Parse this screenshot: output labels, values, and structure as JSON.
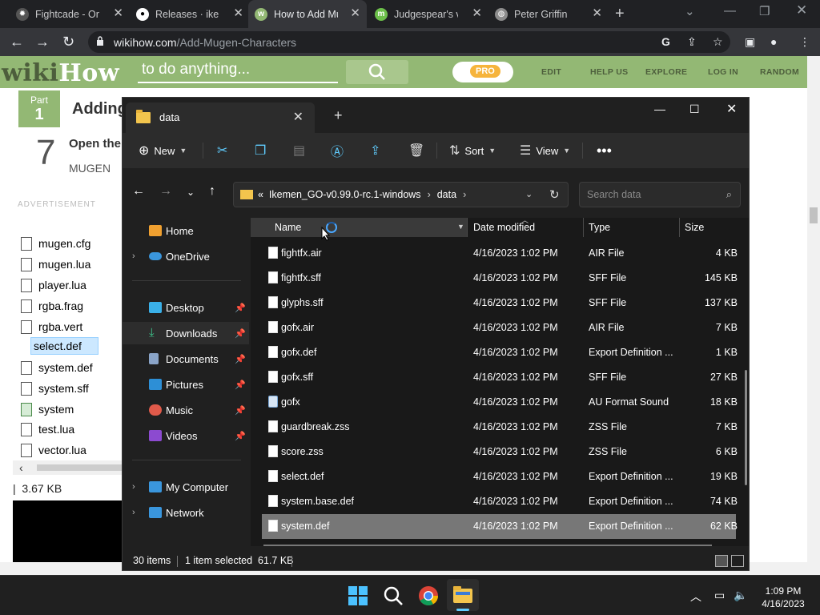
{
  "browser": {
    "tabs": [
      {
        "title": "Fightcade - Onl",
        "icon": "fightcade-icon",
        "color": "#6b6b6b"
      },
      {
        "title": "Releases · ikem",
        "icon": "github-icon",
        "color": "#ffffff"
      },
      {
        "title": "How to Add Mu",
        "icon": "wikihow-icon",
        "color": "#93b874"
      },
      {
        "title": "Judgespear's ve",
        "icon": "judgespear-icon",
        "color": "#6cc04a"
      },
      {
        "title": "Peter Griffin",
        "icon": "globe-icon",
        "color": "#8c8c8c"
      }
    ],
    "url_domain": "wikihow.com",
    "url_path": "/Add-Mugen-Characters"
  },
  "wikihow": {
    "logo_wiki": "wiki",
    "logo_how": "How",
    "search_placeholder": "to do anything...",
    "pro_label": "PRO",
    "nav": [
      "EDIT",
      "HELP US",
      "EXPLORE",
      "LOG IN",
      "RANDOM"
    ],
    "part_label": "Part",
    "part_number": "1",
    "heading": "Adding",
    "step_number": "7",
    "step_title": "Open the",
    "step_text": "MUGEN",
    "ad_label": "ADVERTISEMENT",
    "bg_files": [
      "mugen.cfg",
      "mugen.lua",
      "player.lua",
      "rgba.frag",
      "rgba.vert",
      "select.def",
      "system.def",
      "system.sff",
      "system",
      "test.lua",
      "vector.lua"
    ],
    "bg_status": "3.67 KB"
  },
  "explorer": {
    "tab_title": "data",
    "commands": {
      "new": "New",
      "sort": "Sort",
      "view": "View"
    },
    "breadcrumb": [
      "Ikemen_GO-v0.99.0-rc.1-windows",
      "data"
    ],
    "search_placeholder": "Search data",
    "nav_pane": [
      {
        "label": "Home",
        "icon": "home-icon",
        "color": "#f0a030",
        "arrow": "",
        "pin": false
      },
      {
        "label": "OneDrive",
        "icon": "onedrive-icon",
        "color": "#3a96dd",
        "arrow": "›",
        "pin": false
      },
      {
        "label": "Desktop",
        "icon": "desktop-icon",
        "color": "#3ab0e8",
        "arrow": "",
        "pin": true
      },
      {
        "label": "Downloads",
        "icon": "downloads-icon",
        "color": "#3ec58c",
        "arrow": "",
        "pin": true
      },
      {
        "label": "Documents",
        "icon": "documents-icon",
        "color": "#8aa4c8",
        "arrow": "",
        "pin": true
      },
      {
        "label": "Pictures",
        "icon": "pictures-icon",
        "color": "#2d8fd6",
        "arrow": "",
        "pin": true
      },
      {
        "label": "Music",
        "icon": "music-icon",
        "color": "#e05a4a",
        "arrow": "",
        "pin": true
      },
      {
        "label": "Videos",
        "icon": "videos-icon",
        "color": "#8c4ad0",
        "arrow": "",
        "pin": true
      },
      {
        "label": "My Computer",
        "icon": "computer-icon",
        "color": "#3a96dd",
        "arrow": "›",
        "pin": false
      },
      {
        "label": "Network",
        "icon": "network-icon",
        "color": "#3a96dd",
        "arrow": "›",
        "pin": false
      }
    ],
    "columns": [
      "Name",
      "Date modified",
      "Type",
      "Size"
    ],
    "files": [
      {
        "name": "fightfx.air",
        "date": "4/16/2023 1:02 PM",
        "type": "AIR File",
        "size": "4 KB"
      },
      {
        "name": "fightfx.sff",
        "date": "4/16/2023 1:02 PM",
        "type": "SFF File",
        "size": "145 KB"
      },
      {
        "name": "glyphs.sff",
        "date": "4/16/2023 1:02 PM",
        "type": "SFF File",
        "size": "137 KB"
      },
      {
        "name": "gofx.air",
        "date": "4/16/2023 1:02 PM",
        "type": "AIR File",
        "size": "7 KB"
      },
      {
        "name": "gofx.def",
        "date": "4/16/2023 1:02 PM",
        "type": "Export Definition ...",
        "size": "1 KB"
      },
      {
        "name": "gofx.sff",
        "date": "4/16/2023 1:02 PM",
        "type": "SFF File",
        "size": "27 KB"
      },
      {
        "name": "gofx",
        "date": "4/16/2023 1:02 PM",
        "type": "AU Format Sound",
        "size": "18 KB"
      },
      {
        "name": "guardbreak.zss",
        "date": "4/16/2023 1:02 PM",
        "type": "ZSS File",
        "size": "7 KB"
      },
      {
        "name": "score.zss",
        "date": "4/16/2023 1:02 PM",
        "type": "ZSS File",
        "size": "6 KB"
      },
      {
        "name": "select.def",
        "date": "4/16/2023 1:02 PM",
        "type": "Export Definition ...",
        "size": "19 KB"
      },
      {
        "name": "system.base.def",
        "date": "4/16/2023 1:02 PM",
        "type": "Export Definition ...",
        "size": "74 KB"
      },
      {
        "name": "system.def",
        "date": "4/16/2023 1:02 PM",
        "type": "Export Definition ...",
        "size": "62 KB"
      }
    ],
    "status": {
      "items": "30 items",
      "selected": "1 item selected  61.7 KB"
    }
  },
  "taskbar": {
    "time": "1:09 PM",
    "date": "4/16/2023"
  }
}
